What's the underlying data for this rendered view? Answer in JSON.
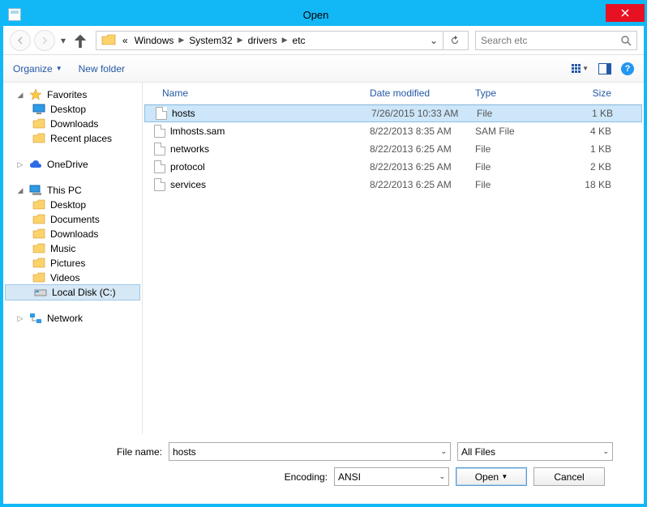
{
  "window": {
    "title": "Open"
  },
  "nav": {
    "crumbs": [
      "«",
      "Windows",
      "System32",
      "drivers",
      "etc"
    ],
    "search_placeholder": "Search etc"
  },
  "toolbar": {
    "organize": "Organize",
    "newfolder": "New folder"
  },
  "sidebar": {
    "favorites": {
      "label": "Favorites",
      "items": [
        "Desktop",
        "Downloads",
        "Recent places"
      ]
    },
    "onedrive": "OneDrive",
    "thispc": {
      "label": "This PC",
      "items": [
        "Desktop",
        "Documents",
        "Downloads",
        "Music",
        "Pictures",
        "Videos",
        "Local Disk (C:)"
      ],
      "selected": "Local Disk (C:)"
    },
    "network": "Network"
  },
  "columns": {
    "name": "Name",
    "date": "Date modified",
    "type": "Type",
    "size": "Size"
  },
  "files": [
    {
      "name": "hosts",
      "date": "7/26/2015 10:33 AM",
      "type": "File",
      "size": "1 KB",
      "selected": true
    },
    {
      "name": "lmhosts.sam",
      "date": "8/22/2013 8:35 AM",
      "type": "SAM File",
      "size": "4 KB"
    },
    {
      "name": "networks",
      "date": "8/22/2013 6:25 AM",
      "type": "File",
      "size": "1 KB"
    },
    {
      "name": "protocol",
      "date": "8/22/2013 6:25 AM",
      "type": "File",
      "size": "2 KB"
    },
    {
      "name": "services",
      "date": "8/22/2013 6:25 AM",
      "type": "File",
      "size": "18 KB"
    }
  ],
  "footer": {
    "filename_label": "File name:",
    "filename_value": "hosts",
    "filter": "All Files",
    "encoding_label": "Encoding:",
    "encoding_value": "ANSI",
    "open": "Open",
    "cancel": "Cancel"
  }
}
